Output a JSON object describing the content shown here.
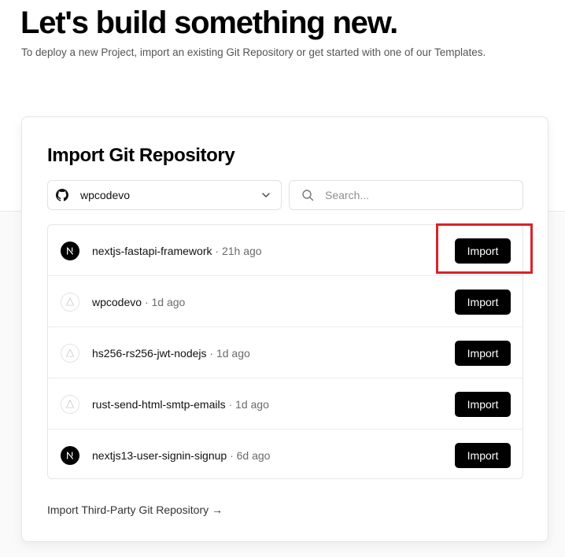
{
  "hero": {
    "title": "Let's build something new.",
    "subtitle": "To deploy a new Project, import an existing Git Repository or get started with one of our Templates."
  },
  "import_card": {
    "title": "Import Git Repository",
    "account_selector": {
      "value": "wpcodevo",
      "icon": "github-icon"
    },
    "search": {
      "placeholder": "Search..."
    },
    "repositories": [
      {
        "name": "nextjs-fastapi-framework",
        "time": "· 21h ago",
        "icon": "nextjs-icon",
        "button": "Import",
        "highlighted": true
      },
      {
        "name": "wpcodevo",
        "time": "· 1d ago",
        "icon": "triangle-icon",
        "button": "Import"
      },
      {
        "name": "hs256-rs256-jwt-nodejs",
        "time": "· 1d ago",
        "icon": "triangle-icon",
        "button": "Import"
      },
      {
        "name": "rust-send-html-smtp-emails",
        "time": "· 1d ago",
        "icon": "triangle-icon",
        "button": "Import"
      },
      {
        "name": "nextjs13-user-signin-signup",
        "time": "· 6d ago",
        "icon": "nextjs-icon",
        "button": "Import"
      }
    ],
    "third_party_link": "Import Third-Party Git Repository →"
  },
  "colors": {
    "accent": "#000000",
    "highlight": "#d8232a",
    "muted_text": "#6b6b6b"
  }
}
